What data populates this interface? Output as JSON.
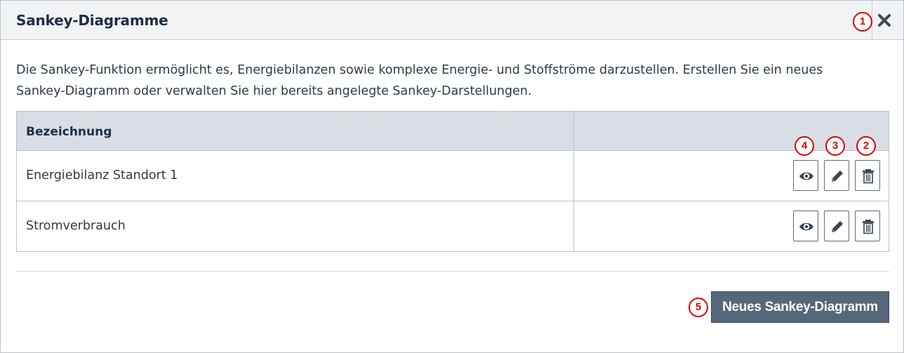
{
  "dialog": {
    "title": "Sankey-Diagramme",
    "description": "Die Sankey-Funktion ermöglicht es, Energiebilanzen sowie komplexe Energie- und Stoffströme darzustellen. Erstellen Sie ein neues Sankey-Diagramm oder verwalten Sie hier bereits angelegte Sankey-Darstellungen."
  },
  "table": {
    "column_header": "Bezeichnung",
    "rows": [
      {
        "label": "Energiebilanz Standort 1"
      },
      {
        "label": "Stromverbrauch"
      }
    ]
  },
  "footer": {
    "new_button_label": "Neues Sankey-Diagramm"
  },
  "markers": [
    "1",
    "2",
    "3",
    "4",
    "5"
  ],
  "colors": {
    "marker": "#e00000",
    "header_bg": "#f1f3f5",
    "table_header_bg": "#d9dee5",
    "button_bg": "#56677a"
  }
}
